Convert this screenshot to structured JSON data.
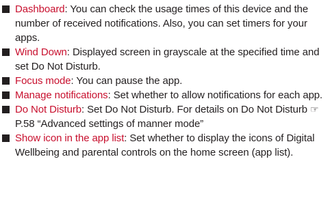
{
  "items": [
    {
      "term": "Dashboard",
      "separator": ": ",
      "text": "You can check the usage times of this device and the number of received notifications. Also, you can set timers for your apps."
    },
    {
      "term": "Wind Down",
      "separator": ": ",
      "text": "Displayed screen in grayscale at the specified time and set Do Not Disturb."
    },
    {
      "term": "Focus mode",
      "separator": ": ",
      "text": "You can pause the app."
    },
    {
      "term": "Manage notifications",
      "separator": ": ",
      "text": "Set whether to allow notifications for each app."
    },
    {
      "term": "Do Not Disturb",
      "separator": ": ",
      "text": "Set Do Not Disturb. For details on Do Not Disturb ",
      "ref_icon": "☞",
      "ref_text": "P.58 “Advanced settings of manner mode”"
    },
    {
      "term": "Show icon in the app list",
      "separator": ": ",
      "text": "Set whether to display the icons of Digital Wellbeing and parental controls on the home screen (app list)."
    }
  ],
  "colors": {
    "term": "#c8102e",
    "text": "#231f20"
  },
  "icons": {
    "bullet": "square-bullet-icon",
    "reference": "reference-pointer-icon"
  }
}
